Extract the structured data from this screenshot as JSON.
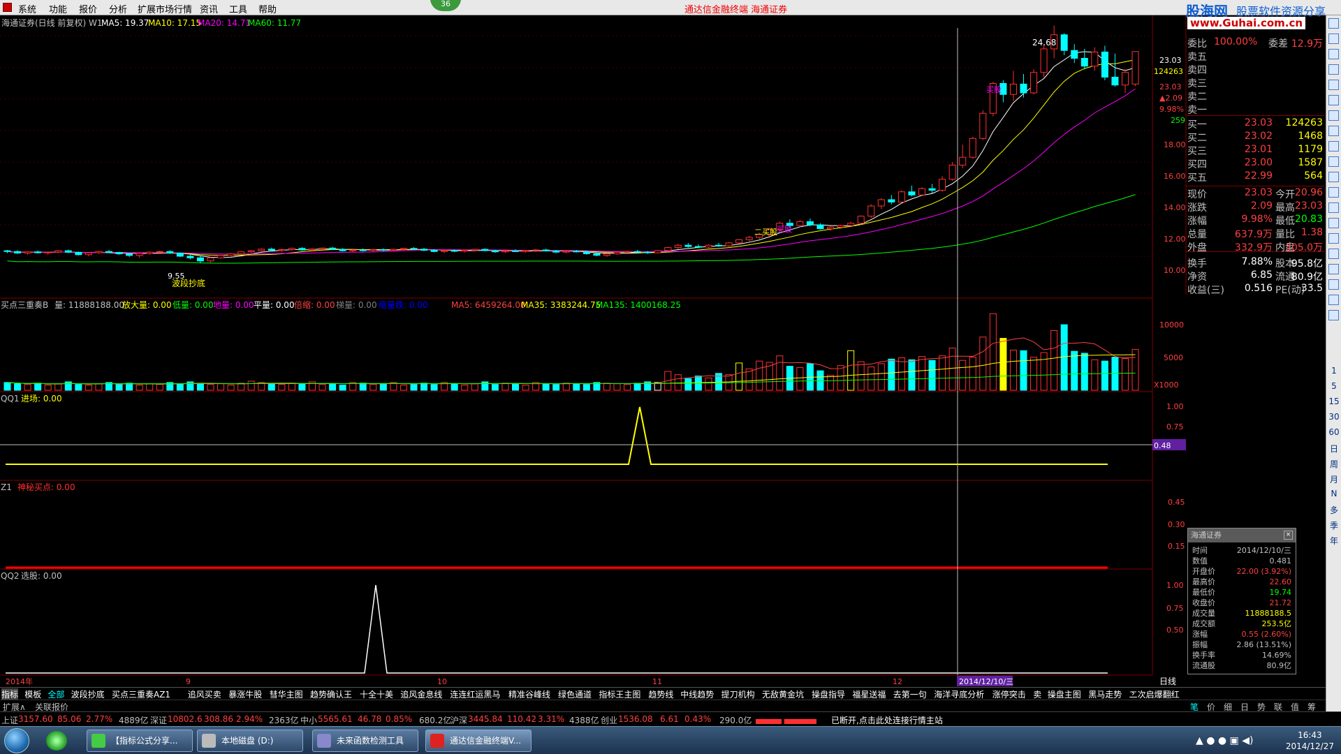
{
  "menubar": {
    "items": [
      "系统",
      "功能",
      "报价",
      "分析",
      "扩展市场行情",
      "资讯",
      "工具",
      "帮助"
    ],
    "badge": "36",
    "center_title": "通达信金融终端    海通证券",
    "brand": "股海网",
    "brand_sub": "股票软件资源分享",
    "brand_url": "www.Guhai.com.cn"
  },
  "main_chart": {
    "title": "海通证券(日线 前复权) W1",
    "ma5": "MA5: 19.37",
    "ma10": "MA10: 17.15",
    "ma20": "MA20: 14.71",
    "ma60": "MA60: 11.77",
    "high_label": "24.68",
    "low_label": "9.55",
    "annot1": "买股",
    "annot2": "买股",
    "annot3": "二买股",
    "annot4": "波段抄底",
    "price_ticks": [
      "18.00",
      "16.00",
      "14.00",
      "12.00",
      "10.00"
    ],
    "side_vals": {
      "price": "23.03",
      "vol": "124263",
      "cur": "23.03",
      "chg": "▲2.09",
      "pct": "9.98%",
      "n": "259"
    },
    "colors": {
      "ma5": "#ffffff",
      "ma10": "#ffff00",
      "ma20": "#ff00ff",
      "ma60": "#00ff00",
      "up": "#ff3030",
      "down": "#00ffff"
    }
  },
  "candles": [
    [
      10.35,
      10.4,
      10.2,
      10.3
    ],
    [
      10.3,
      10.38,
      10.15,
      10.2
    ],
    [
      10.2,
      10.32,
      10.1,
      10.28
    ],
    [
      10.28,
      10.36,
      10.18,
      10.22
    ],
    [
      10.22,
      10.3,
      10.1,
      10.26
    ],
    [
      10.26,
      10.4,
      10.2,
      10.35
    ],
    [
      10.35,
      10.42,
      10.2,
      10.25
    ],
    [
      10.25,
      10.3,
      10.05,
      10.1
    ],
    [
      10.1,
      10.25,
      10.0,
      10.22
    ],
    [
      10.22,
      10.34,
      10.15,
      10.3
    ],
    [
      10.3,
      10.4,
      10.2,
      10.24
    ],
    [
      10.24,
      10.28,
      10.1,
      10.15
    ],
    [
      10.15,
      10.22,
      9.95,
      10.05
    ],
    [
      10.05,
      10.2,
      9.9,
      10.18
    ],
    [
      10.18,
      10.3,
      10.1,
      10.26
    ],
    [
      10.26,
      10.36,
      10.2,
      10.3
    ],
    [
      10.3,
      10.38,
      10.15,
      10.2
    ],
    [
      10.2,
      10.24,
      9.95,
      10.0
    ],
    [
      10.0,
      10.1,
      9.8,
      9.9
    ],
    [
      9.9,
      10.05,
      9.55,
      9.7
    ],
    [
      9.7,
      9.95,
      9.6,
      9.9
    ],
    [
      9.9,
      10.1,
      9.85,
      10.05
    ],
    [
      10.05,
      10.2,
      10.0,
      10.15
    ],
    [
      10.15,
      10.3,
      10.1,
      10.28
    ],
    [
      10.28,
      10.4,
      10.2,
      10.35
    ],
    [
      10.35,
      10.5,
      10.3,
      10.45
    ],
    [
      10.45,
      10.55,
      10.3,
      10.38
    ],
    [
      10.38,
      10.48,
      10.25,
      10.42
    ],
    [
      10.42,
      10.55,
      10.35,
      10.5
    ],
    [
      10.5,
      10.58,
      10.35,
      10.4
    ],
    [
      10.4,
      10.5,
      10.3,
      10.46
    ],
    [
      10.46,
      10.56,
      10.4,
      10.52
    ],
    [
      10.52,
      10.6,
      10.4,
      10.44
    ],
    [
      10.44,
      10.52,
      10.3,
      10.35
    ],
    [
      10.35,
      10.45,
      10.25,
      10.4
    ],
    [
      10.4,
      10.5,
      10.3,
      10.36
    ],
    [
      10.36,
      10.46,
      10.28,
      10.42
    ],
    [
      10.42,
      10.5,
      10.32,
      10.38
    ],
    [
      10.38,
      10.48,
      10.3,
      10.44
    ],
    [
      10.44,
      10.54,
      10.36,
      10.5
    ],
    [
      10.5,
      10.58,
      10.4,
      10.45
    ],
    [
      10.45,
      10.52,
      10.32,
      10.38
    ],
    [
      10.38,
      10.46,
      10.25,
      10.3
    ],
    [
      10.3,
      10.4,
      10.2,
      10.36
    ],
    [
      10.36,
      10.44,
      10.26,
      10.32
    ],
    [
      10.32,
      10.42,
      10.24,
      10.38
    ],
    [
      10.38,
      10.48,
      10.3,
      10.44
    ],
    [
      10.44,
      10.5,
      10.32,
      10.36
    ],
    [
      10.36,
      10.42,
      10.22,
      10.28
    ],
    [
      10.28,
      10.38,
      10.2,
      10.34
    ],
    [
      10.34,
      10.44,
      10.26,
      10.3
    ],
    [
      10.3,
      10.4,
      10.22,
      10.36
    ],
    [
      10.36,
      10.46,
      10.28,
      10.4
    ],
    [
      10.4,
      10.48,
      10.3,
      10.34
    ],
    [
      10.34,
      10.4,
      10.2,
      10.26
    ],
    [
      10.26,
      10.36,
      10.18,
      10.32
    ],
    [
      10.32,
      10.4,
      10.24,
      10.28
    ],
    [
      10.28,
      10.36,
      10.1,
      10.16
    ],
    [
      10.16,
      10.26,
      10.0,
      10.06
    ],
    [
      10.06,
      10.2,
      9.95,
      10.15
    ],
    [
      10.15,
      10.3,
      10.1,
      10.25
    ],
    [
      10.25,
      10.36,
      10.18,
      10.3
    ],
    [
      10.3,
      10.4,
      10.22,
      10.26
    ],
    [
      10.26,
      10.34,
      10.15,
      10.22
    ],
    [
      10.22,
      10.4,
      10.18,
      10.36
    ],
    [
      10.36,
      10.6,
      10.3,
      10.55
    ],
    [
      10.55,
      10.8,
      10.45,
      10.7
    ],
    [
      10.7,
      10.85,
      10.55,
      10.62
    ],
    [
      10.62,
      10.75,
      10.5,
      10.58
    ],
    [
      10.58,
      10.76,
      10.5,
      10.7
    ],
    [
      10.7,
      10.85,
      10.6,
      10.66
    ],
    [
      10.66,
      10.9,
      10.6,
      10.85
    ],
    [
      10.85,
      11.1,
      10.8,
      11.05
    ],
    [
      11.05,
      11.3,
      10.95,
      11.2
    ],
    [
      11.2,
      11.5,
      11.1,
      11.4
    ],
    [
      11.4,
      11.8,
      11.3,
      11.7
    ],
    [
      11.7,
      12.2,
      11.6,
      12.1
    ],
    [
      12.1,
      12.35,
      11.8,
      11.95
    ],
    [
      11.95,
      12.3,
      11.85,
      12.2
    ],
    [
      12.2,
      12.4,
      11.9,
      12.0
    ],
    [
      12.0,
      12.1,
      11.7,
      11.75
    ],
    [
      11.75,
      11.9,
      11.6,
      11.85
    ],
    [
      11.85,
      12.0,
      11.75,
      11.95
    ],
    [
      11.95,
      12.2,
      11.85,
      12.1
    ],
    [
      12.1,
      12.6,
      12.0,
      12.55
    ],
    [
      12.55,
      13.3,
      12.45,
      13.2
    ],
    [
      13.2,
      13.7,
      13.0,
      13.6
    ],
    [
      13.6,
      13.9,
      13.3,
      13.45
    ],
    [
      13.45,
      14.2,
      13.4,
      14.1
    ],
    [
      14.1,
      14.5,
      13.8,
      13.9
    ],
    [
      13.9,
      14.4,
      13.85,
      14.3
    ],
    [
      14.3,
      14.6,
      14.0,
      14.2
    ],
    [
      14.2,
      15.1,
      14.1,
      14.9
    ],
    [
      14.9,
      16.0,
      14.8,
      15.8
    ],
    [
      15.8,
      17.1,
      15.6,
      16.3
    ],
    [
      16.3,
      17.6,
      16.2,
      17.5
    ],
    [
      17.5,
      19.3,
      17.4,
      19.1
    ],
    [
      19.1,
      21.1,
      18.9,
      21.0
    ],
    [
      21.0,
      21.2,
      19.8,
      20.3
    ],
    [
      20.3,
      21.8,
      19.9,
      20.96
    ],
    [
      20.96,
      21.6,
      20.1,
      20.4
    ],
    [
      20.4,
      21.9,
      20.3,
      21.7
    ],
    [
      21.7,
      23.5,
      21.4,
      23.2
    ],
    [
      23.2,
      24.68,
      22.6,
      24.1
    ],
    [
      24.1,
      24.2,
      22.8,
      23.1
    ],
    [
      23.1,
      23.5,
      22.3,
      22.6
    ],
    [
      22.6,
      23.2,
      21.9,
      22.1
    ],
    [
      22.1,
      23.3,
      21.8,
      23.0
    ],
    [
      23.0,
      23.4,
      21.2,
      21.4
    ],
    [
      21.4,
      22.9,
      20.8,
      20.9
    ],
    [
      20.9,
      21.9,
      20.4,
      21.7
    ],
    [
      20.96,
      23.03,
      20.83,
      23.03
    ]
  ],
  "volume_panel": {
    "title": "买点三重奏B",
    "vol": "量: 11888188.00",
    "fangda": "放大量: 0.00",
    "di": "低量: 0.00",
    "di2": "地量: 0.00",
    "ping": "平量: 0.00",
    "bei": "倍缩: 0.00",
    "ti": "梯量: 0.00",
    "lian": "缩量跌: 0.00",
    "ma5": "MA5: 6459264.00",
    "ma35": "MA35: 3383244.75",
    "ma135": "MA135: 1400168.25",
    "ticks": [
      "10000",
      "5000",
      "X1000"
    ]
  },
  "volumes": [
    1.2,
    1.0,
    0.9,
    1.1,
    0.8,
    1.0,
    1.3,
    0.9,
    0.8,
    1.0,
    1.2,
    0.9,
    1.1,
    0.8,
    1.0,
    0.9,
    1.2,
    1.0,
    1.3,
    1.1,
    0.9,
    1.0,
    0.8,
    1.1,
    1.4,
    1.2,
    1.0,
    0.9,
    1.1,
    1.0,
    1.3,
    0.9,
    1.0,
    0.8,
    1.2,
    1.1,
    0.9,
    1.0,
    1.2,
    0.8,
    1.0,
    1.1,
    0.9,
    1.2,
    1.0,
    0.8,
    1.0,
    1.3,
    0.9,
    1.1,
    1.0,
    0.8,
    1.2,
    1.0,
    0.9,
    1.1,
    1.0,
    0.9,
    1.2,
    1.1,
    1.0,
    0.9,
    1.1,
    1.3,
    1.2,
    2.9,
    2.4,
    1.8,
    2.2,
    1.9,
    2.6,
    2.4,
    4.2,
    3.3,
    4.5,
    4.3,
    5.3,
    3.7,
    3.5,
    4.1,
    3.0,
    2.3,
    3.8,
    6.1,
    4.4,
    3.6,
    4.1,
    4.8,
    5.0,
    4.7,
    5.2,
    4.6,
    5.3,
    6.5,
    4.6,
    5.1,
    8.2,
    11.8,
    8.0,
    6.2,
    6.1,
    5.1,
    5.8,
    9.2,
    10.1,
    6.0,
    5.7,
    4.7,
    4.5,
    5.1,
    4.9,
    6.3
  ],
  "qq1_panel": {
    "title": "QQ1",
    "label": "进场: 0.00",
    "ticks": [
      "1.00",
      "0.75"
    ],
    "cursor": "0.48"
  },
  "z1_panel": {
    "title": "Z1",
    "label": "神秘买点: 0.00",
    "ticks": [
      "0.45",
      "0.30",
      "0.15"
    ]
  },
  "qq2_panel": {
    "title": "QQ2",
    "label": "选股: 0.00",
    "ticks": [
      "1.00",
      "0.75",
      "0.50"
    ]
  },
  "x_axis": {
    "labels": [
      "2014年",
      "9",
      "10",
      "11",
      "12"
    ],
    "cursor_date": "2014/12/10/三",
    "right": "日线"
  },
  "quote": {
    "header": [
      [
        "委比",
        "100.00%"
      ],
      [
        "委差",
        "12.9万"
      ]
    ],
    "sells": [
      "卖五",
      "卖四",
      "卖三",
      "卖二",
      "卖一"
    ],
    "buys": [
      [
        "买一",
        "23.03",
        "124263"
      ],
      [
        "买二",
        "23.02",
        "1468"
      ],
      [
        "买三",
        "23.01",
        "1179"
      ],
      [
        "买四",
        "23.00",
        "1587"
      ],
      [
        "买五",
        "22.99",
        "564"
      ]
    ],
    "stats": [
      [
        "现价",
        "23.03",
        "今开",
        "20.96"
      ],
      [
        "涨跌",
        "2.09",
        "最高",
        "23.03"
      ],
      [
        "涨幅",
        "9.98%",
        "最低",
        "20.83"
      ],
      [
        "总量",
        "637.9万",
        "量比",
        "1.38"
      ],
      [
        "外盘",
        "332.9万",
        "内盘",
        "305.0万"
      ],
      [
        "换手",
        "7.88%",
        "股本",
        "95.8亿"
      ],
      [
        "净资",
        "6.85",
        "流通",
        "80.9亿"
      ],
      [
        "收益(三)",
        "0.516",
        "PE(动)",
        "33.5"
      ]
    ]
  },
  "info_box": {
    "title": "海通证券",
    "rows": [
      [
        "时间",
        "2014/12/10/三",
        "#c0c0c0"
      ],
      [
        "数值",
        "0.481",
        "#c0c0c0"
      ],
      [
        "开盘价",
        "22.00 (3.92%)",
        "#ff4040"
      ],
      [
        "最高价",
        "22.60",
        "#ff4040"
      ],
      [
        "最低价",
        "19.74",
        "#00ff00"
      ],
      [
        "收盘价",
        "21.72",
        "#ff4040"
      ],
      [
        "成交量",
        "11888188.5",
        "#ffff00"
      ],
      [
        "成交额",
        "253.5亿",
        "#ffff00"
      ],
      [
        "涨幅",
        "0.55 (2.60%)",
        "#ff4040"
      ],
      [
        "振幅",
        "2.86 (13.51%)",
        "#c0c0c0"
      ],
      [
        "换手率",
        "14.69%",
        "#c0c0c0"
      ],
      [
        "流通股",
        "80.9亿",
        "#c0c0c0"
      ]
    ]
  },
  "tabs": [
    "指标",
    "模板",
    "全部",
    "波段抄底",
    "买点三重奏AZ1",
    "追风买卖",
    "暴涨牛股",
    "彗华主图",
    "趋势确认王",
    "十全十美",
    "追风金息线",
    "连连红运黑马",
    "精准谷峰线",
    "绿色通道",
    "指标王主图",
    "趋势线",
    "中线趋势",
    "提刀机构",
    "无敌黄金坑",
    "操盘指导",
    "福星送福",
    "去第一句",
    "海洋寻底分析",
    "涨停突击",
    "卖",
    "操盘主图",
    "黑马走势",
    "二次启爆翻红"
  ],
  "tabs2": [
    "扩展∧",
    "关联报价"
  ],
  "right_tabs": [
    "笔",
    "价",
    "细",
    "日",
    "势",
    "联",
    "值",
    "筹"
  ],
  "status": {
    "sh_label": "上证",
    "sh": "3157.60",
    "sh_chg": "85.06",
    "sh_pct": "2.77%",
    "sh_amt": "4889亿",
    "sz_label": "深证",
    "sz": "10802.6",
    "sz_chg": "308.86",
    "sz_pct": "2.94%",
    "sz_amt": "2363亿",
    "zx_label": "中小",
    "zx": "5565.61",
    "zx_chg": "46.78",
    "zx_pct": "0.85%",
    "zx_amt": "680.2亿",
    "hs_label": "沪深",
    "hs": "3445.84",
    "hs_chg": "110.42",
    "hs_pct": "3.31%",
    "hs_amt": "4388亿",
    "cy_label": "创业",
    "cy": "1536.08",
    "cy_chg": "6.61",
    "cy_pct": "0.43%",
    "cy_amt": "290.0亿",
    "msg": "已断开,点击此处连接行情主站"
  },
  "taskbar": {
    "buttons": [
      "【指标公式分享...",
      "本地磁盘 (D:)",
      "未来函数检测工具",
      "通达信金融终端V..."
    ],
    "time": "16:43",
    "date": "2014/12/27"
  },
  "right_toolbar_chars": [
    "1",
    "5",
    "15",
    "30",
    "60",
    "日",
    "周",
    "月",
    "N",
    "多",
    "季",
    "年"
  ]
}
